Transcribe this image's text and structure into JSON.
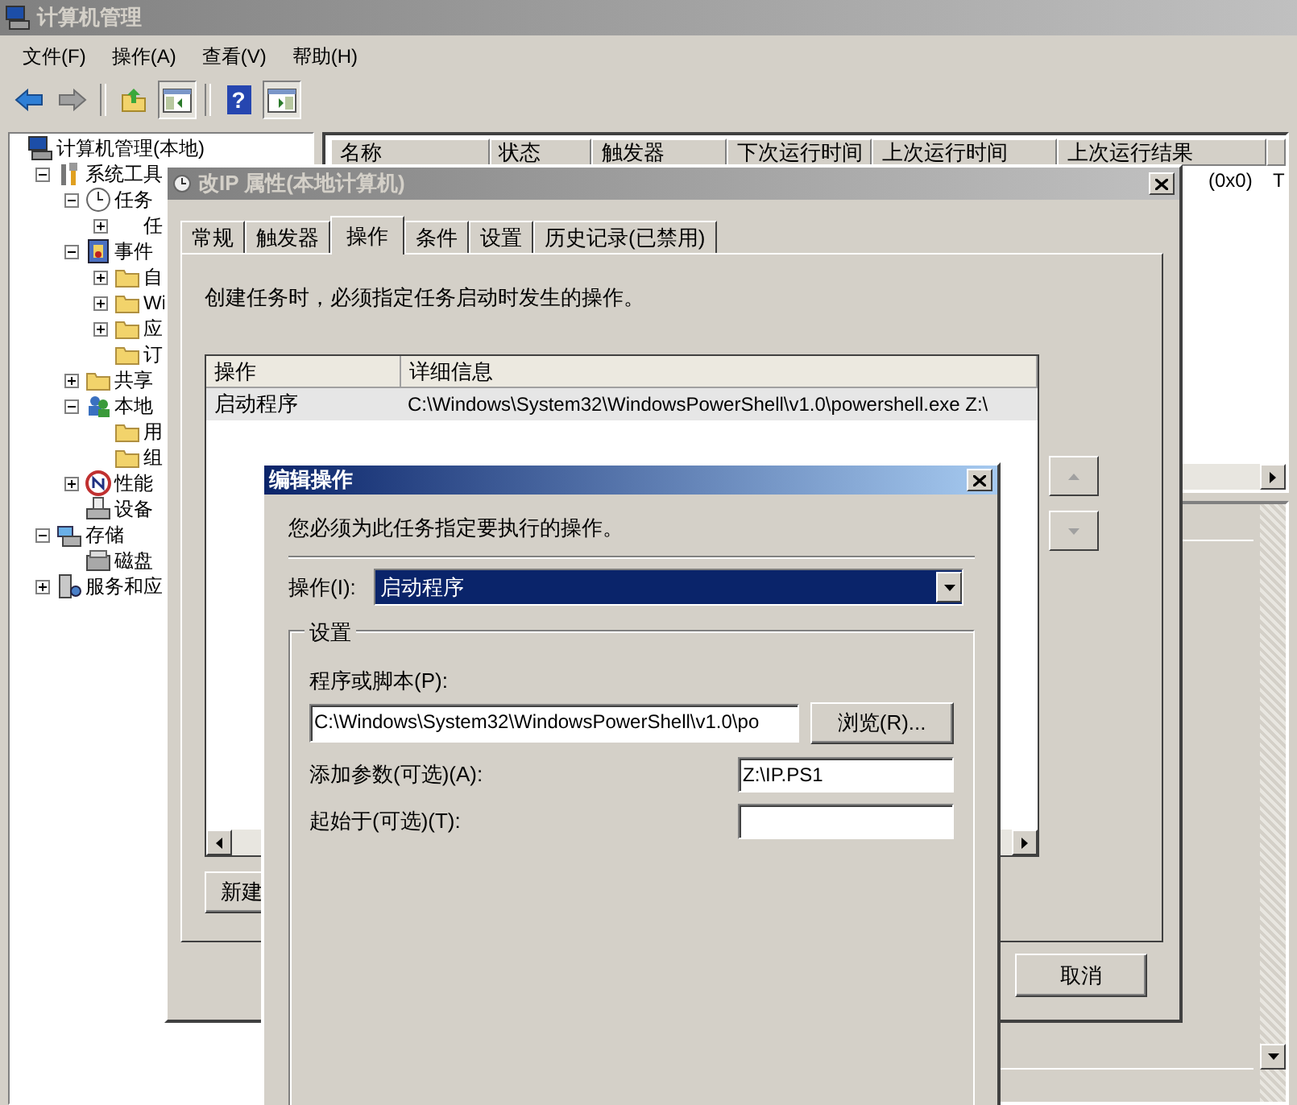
{
  "main_window": {
    "title": "计算机管理",
    "active": false,
    "menu": [
      "文件(F)",
      "操作(A)",
      "查看(V)",
      "帮助(H)"
    ],
    "toolbar": [
      {
        "kind": "back",
        "disabled": false,
        "pressed": false
      },
      {
        "kind": "forward",
        "disabled": true,
        "pressed": false
      },
      {
        "kind": "separator"
      },
      {
        "kind": "up",
        "disabled": false,
        "pressed": false
      },
      {
        "kind": "tree-pane",
        "disabled": false,
        "pressed": true
      },
      {
        "kind": "separator"
      },
      {
        "kind": "help",
        "glyph": "?",
        "disabled": false,
        "pressed": false
      },
      {
        "kind": "action-pane",
        "disabled": false,
        "pressed": true
      }
    ],
    "tree": [
      {
        "label": "计算机管理(本地)",
        "kind": "computer",
        "children": [
          {
            "label": "系统工具",
            "kind": "tools",
            "expanded": true,
            "children": [
              {
                "label": "任务",
                "kind": "clock",
                "expanded": true,
                "children": [
                  {
                    "label": "任",
                    "kind": "blank",
                    "expanded": false
                  }
                ]
              },
              {
                "label": "事件",
                "kind": "log",
                "expanded": true,
                "children": [
                  {
                    "label": "自",
                    "kind": "folder",
                    "expanded": false
                  },
                  {
                    "label": "Wi",
                    "kind": "folder",
                    "expanded": false
                  },
                  {
                    "label": "应",
                    "kind": "folder",
                    "expanded": false
                  },
                  {
                    "label": "订",
                    "kind": "folder"
                  }
                ]
              },
              {
                "label": "共享",
                "kind": "folder",
                "expanded": false
              },
              {
                "label": "本地",
                "kind": "users",
                "expanded": true,
                "children": [
                  {
                    "label": "用",
                    "kind": "folder"
                  },
                  {
                    "label": "组",
                    "kind": "folder"
                  }
                ]
              },
              {
                "label": "性能",
                "kind": "gauge",
                "expanded": false
              },
              {
                "label": "设备",
                "kind": "device"
              }
            ]
          },
          {
            "label": "存储",
            "kind": "storage",
            "expanded": true,
            "children": [
              {
                "label": "磁盘",
                "kind": "disk"
              }
            ]
          },
          {
            "label": "服务和应",
            "kind": "services",
            "expanded": false
          }
        ]
      }
    ],
    "task_list": {
      "columns": [
        "名称",
        "状态",
        "触发器",
        "下次运行时间",
        "上次运行时间",
        "上次运行结果"
      ],
      "row_fragments": [
        "(0x0)",
        "T"
      ]
    }
  },
  "properties_dialog": {
    "title": "改IP 属性(本地计算机)",
    "active": false,
    "tabs": [
      {
        "label": "常规",
        "selected": false
      },
      {
        "label": "触发器",
        "selected": false
      },
      {
        "label": "操作",
        "selected": true
      },
      {
        "label": "条件",
        "selected": false
      },
      {
        "label": "设置",
        "selected": false
      },
      {
        "label": "历史记录(已禁用)",
        "selected": false
      }
    ],
    "description": "创建任务时，必须指定任务启动时发生的操作。",
    "actions_table": {
      "columns": [
        "操作",
        "详细信息"
      ],
      "rows": [
        {
          "action": "启动程序",
          "details": "C:\\Windows\\System32\\WindowsPowerShell\\v1.0\\powershell.exe Z:\\",
          "selected": true
        }
      ]
    },
    "new_button": "新建",
    "cancel_button": "取消"
  },
  "edit_dialog": {
    "title": "编辑操作",
    "active": true,
    "description": "您必须为此任务指定要执行的操作。",
    "action_label": "操作(I):",
    "action_value": "启动程序",
    "group_title": "设置",
    "program_label": "程序或脚本(P):",
    "program_value": "C:\\Windows\\System32\\WindowsPowerShell\\v1.0\\po",
    "browse_button": "浏览(R)...",
    "arguments_label": "添加参数(可选)(A):",
    "arguments_value": "Z:\\IP.PS1",
    "start_in_label": "起始于(可选)(T):"
  }
}
